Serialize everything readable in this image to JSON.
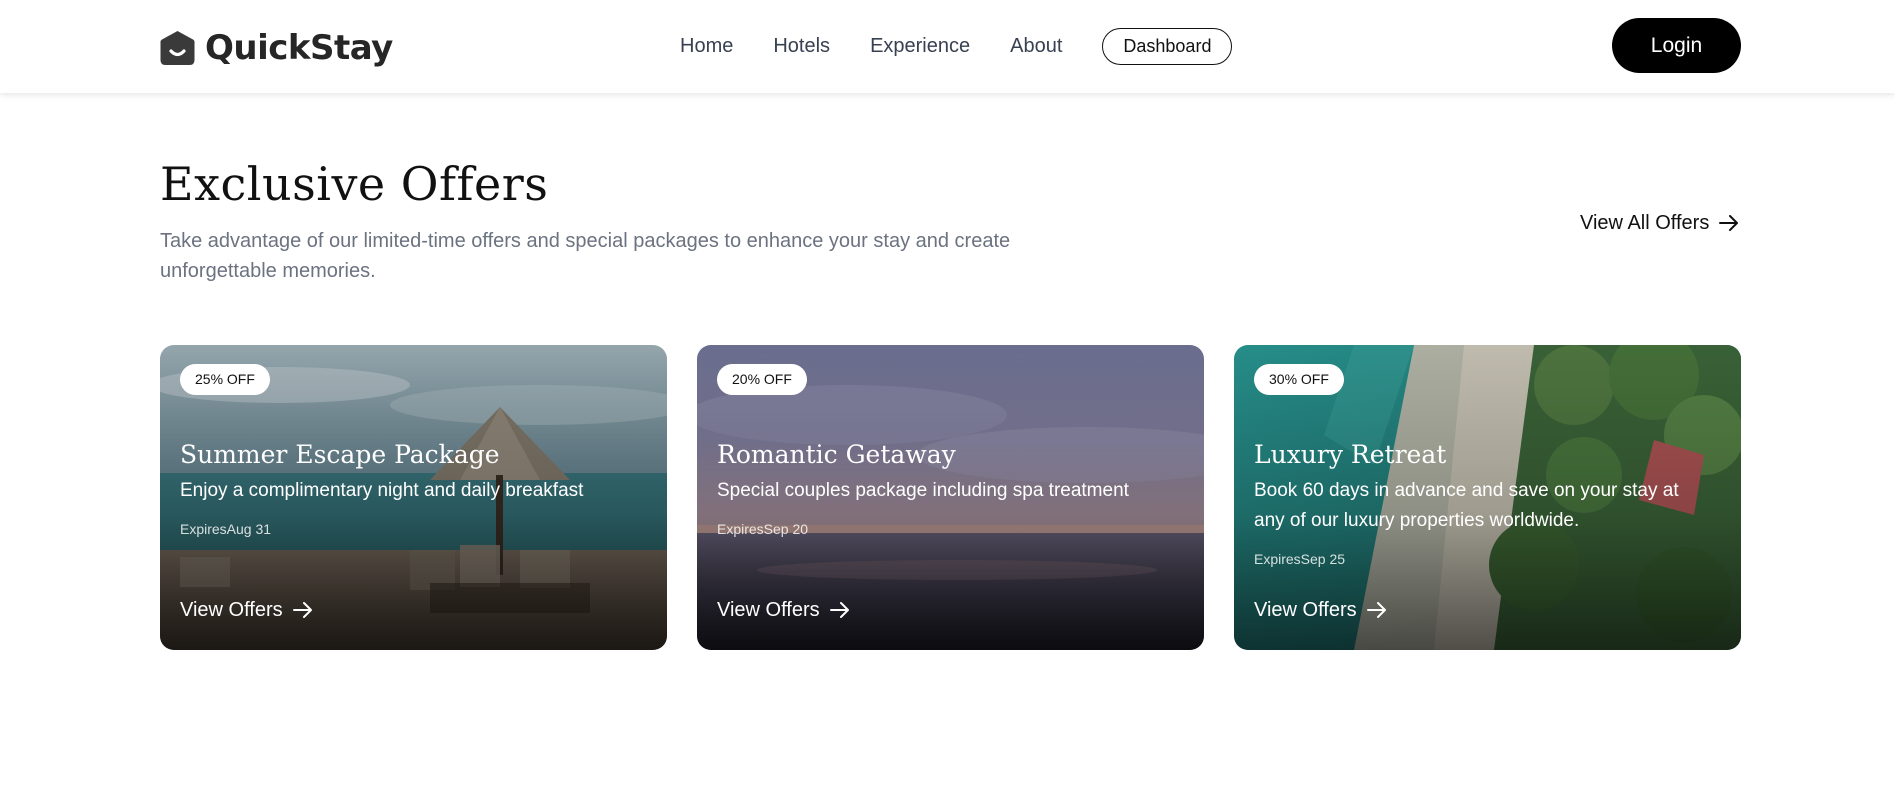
{
  "header": {
    "brand": "QuickStay",
    "nav": [
      "Home",
      "Hotels",
      "Experience",
      "About"
    ],
    "dashboard_label": "Dashboard",
    "login_label": "Login"
  },
  "section": {
    "title": "Exclusive Offers",
    "description": "Take advantage of our limited-time offers and special packages to enhance your stay and create unforgettable memories.",
    "view_all_label": "View All Offers"
  },
  "offers": [
    {
      "badge": "25% OFF",
      "title": "Summer Escape Package",
      "description": "Enjoy a complimentary night and daily breakfast",
      "expires": "ExpiresAug 31",
      "cta": "View Offers"
    },
    {
      "badge": "20% OFF",
      "title": "Romantic Getaway",
      "description": "Special couples package including spa treatment",
      "expires": "ExpiresSep 20",
      "cta": "View Offers"
    },
    {
      "badge": "30% OFF",
      "title": "Luxury Retreat",
      "description": "Book 60 days in advance and save on your stay at any of our luxury properties worldwide.",
      "expires": "ExpiresSep 25",
      "cta": "View Offers"
    }
  ],
  "colors": {
    "primary_button": "#000000",
    "muted_text": "#6b7280",
    "badge_bg": "#ffffff"
  }
}
